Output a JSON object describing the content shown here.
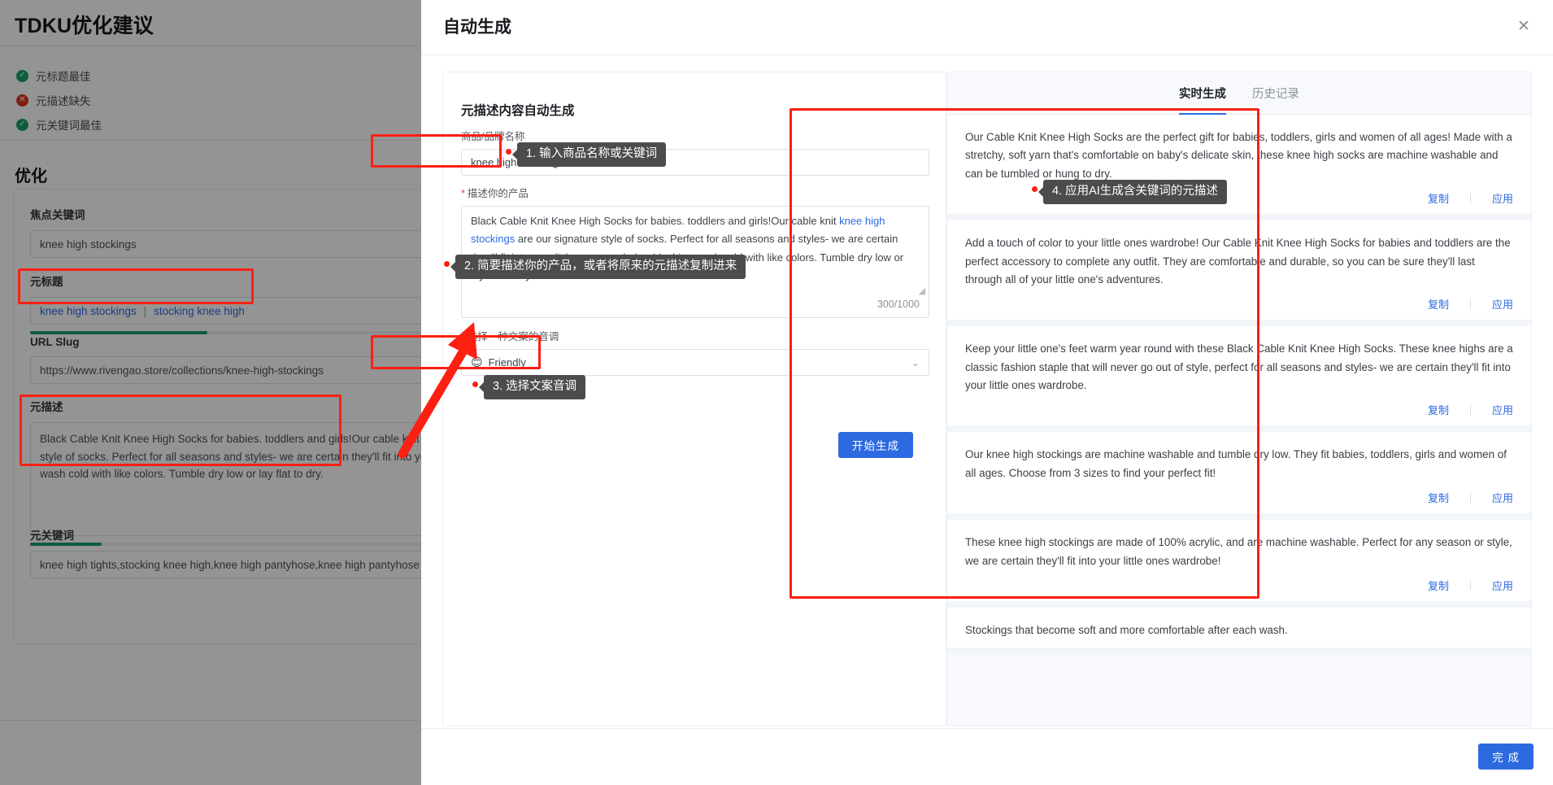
{
  "background": {
    "title": "TDKU优化建议",
    "status_items": [
      {
        "icon": "check-circle-icon",
        "state": "ok",
        "glyph": "✓",
        "label": "元标题最佳"
      },
      {
        "icon": "error-circle-icon",
        "state": "err",
        "glyph": "✕",
        "label": "元描述缺失"
      },
      {
        "icon": "check-circle-icon",
        "state": "ok",
        "glyph": "✓",
        "label": "元关键词最佳"
      }
    ],
    "section_title": "优化",
    "fields": {
      "focus_keyword_label": "焦点关键词",
      "focus_keyword_value": "knee high stockings",
      "meta_title_label": "元标题",
      "meta_title_part1": "knee high stockings",
      "meta_title_sep": "|",
      "meta_title_part2": "stocking knee high",
      "url_slug_label": "URL Slug",
      "url_slug_value": "https://www.rivengao.store/collections/knee-high-stockings",
      "meta_desc_label": "元描述",
      "meta_desc_value": "Black Cable Knit Knee High Socks for babies. toddlers and girls!Our cable knit knee high stockings are our signature style of socks.  Perfect for all seasons and styles- we are certain they'll fit into your little ones wardrobe. Machine wash cold with like colors.  Tumble dry low or lay flat to dry.",
      "meta_keywords_label": "元关键词",
      "meta_keywords_value": "knee high tights,stocking knee high,knee high pantyhose,knee high pantyhose stockings"
    }
  },
  "modal": {
    "title": "自动生成",
    "close_icon": "close-icon",
    "close_glyph": "✕",
    "footer_button": "完 成"
  },
  "form": {
    "title": "元描述内容自动生成",
    "product_name_label": "商品/品牌名称",
    "product_name_value": "knee high stockings",
    "product_desc_label": "描述你的产品",
    "product_desc_required": "*",
    "product_desc_lead": "Black Cable Knit Knee High Socks for babies. toddlers and girls!Our cable knit ",
    "product_desc_link": "knee high stockings",
    "product_desc_tail": " are our signature style of socks.  Perfect for all seasons and styles- we are certain they'll fit into your little ones wardrobe. Machine wash cold with like colors.  Tumble dry low or lay flat to dry.",
    "char_count": "300/1000",
    "tone_label": "选择一种文案的音调",
    "tone_required": "*",
    "tone_emoji": "😊",
    "tone_value": "Friendly",
    "chevron_icon": "chevron-down-icon",
    "chevron_glyph": "⌄",
    "generate_button": "开始生成"
  },
  "results": {
    "tabs": [
      {
        "label": "实时生成",
        "active": true
      },
      {
        "label": "历史记录",
        "active": false
      }
    ],
    "copy_label": "复制",
    "apply_label": "应用",
    "cards": [
      {
        "text": "Our Cable Knit Knee High Socks are the perfect gift for babies, toddlers, girls and women of all ages! Made with a stretchy, soft yarn that's comfortable on baby's delicate skin, these knee high socks are machine washable and can be tumbled or hung to dry."
      },
      {
        "text": "Add a touch of color to your little ones wardrobe! Our Cable Knit Knee High Socks for babies and toddlers are the perfect accessory to complete any outfit. They are comfortable and durable, so you can be sure they'll last through all of your little one's adventures."
      },
      {
        "text": "Keep your little one's feet warm year round with these Black Cable Knit Knee High Socks. These knee highs are a classic fashion staple that will never go out of style, perfect for all seasons and styles- we are certain they'll fit into your little ones wardrobe."
      },
      {
        "text": "Our knee high stockings are machine washable and tumble dry low. They fit babies, toddlers, girls and women of all ages. Choose from 3 sizes to find your perfect fit!"
      },
      {
        "text": "These knee high stockings are made of 100% acrylic, and are machine washable.  Perfect for any season or style, we are certain they'll fit into your little ones wardrobe!"
      },
      {
        "text": "Stockings that become soft and more comfortable after each wash."
      }
    ]
  },
  "annotations": {
    "tips": [
      {
        "id": "tip-1",
        "text": "1. 输入商品名称或关键词"
      },
      {
        "id": "tip-2",
        "text": "2. 简要描述你的产品，或者将原来的元描述复制进来"
      },
      {
        "id": "tip-3",
        "text": "3. 选择文案音调"
      },
      {
        "id": "tip-4",
        "text": "4. 应用AI生成含关键词的元描述"
      }
    ],
    "highlight_color": "#fd1f12"
  }
}
